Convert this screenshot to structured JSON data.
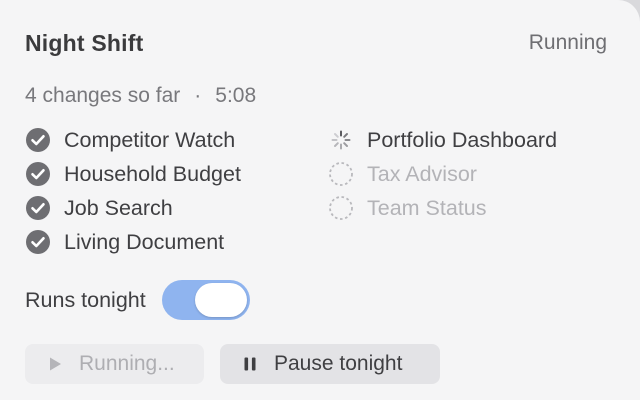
{
  "panel": {
    "title": "Night Shift",
    "status": "Running",
    "changes_text": "4 changes so far",
    "separator": "·",
    "elapsed": "5:08"
  },
  "tasks_done": [
    {
      "label": "Competitor Watch",
      "state": "done",
      "icon": "checkmark-circle-icon"
    },
    {
      "label": "Household Budget",
      "state": "done",
      "icon": "checkmark-circle-icon"
    },
    {
      "label": "Job Search",
      "state": "done",
      "icon": "checkmark-circle-icon"
    },
    {
      "label": "Living Document",
      "state": "done",
      "icon": "checkmark-circle-icon"
    }
  ],
  "tasks_queue": [
    {
      "label": "Portfolio Dashboard",
      "state": "in-progress",
      "icon": "spinner-icon"
    },
    {
      "label": "Tax Advisor",
      "state": "pending",
      "icon": "dashed-circle-icon"
    },
    {
      "label": "Team Status",
      "state": "pending",
      "icon": "dashed-circle-icon"
    }
  ],
  "toggle": {
    "label": "Runs tonight",
    "on": true
  },
  "buttons": {
    "run_label": "Running...",
    "run_disabled": true,
    "pause_label": "Pause tonight"
  },
  "colors": {
    "toggle_on": "#8fb4ef",
    "check_fill": "#6e6e72",
    "pending": "#b3b3b7"
  }
}
